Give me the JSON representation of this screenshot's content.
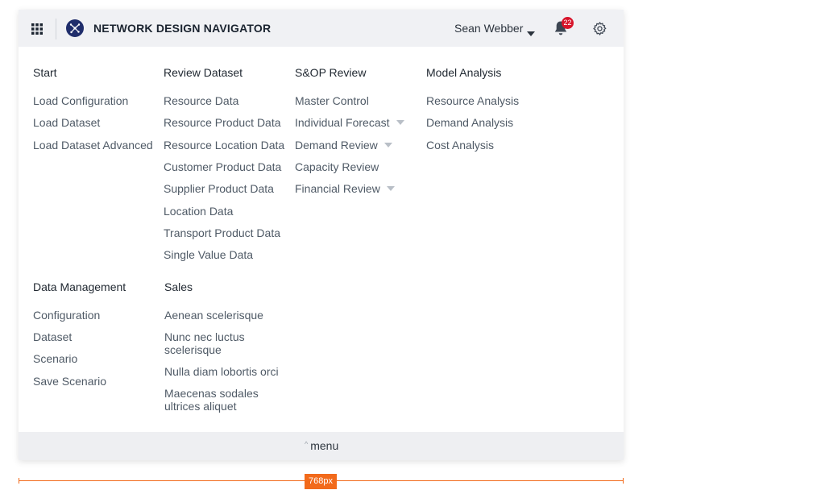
{
  "header": {
    "apps_icon": "grid-icon",
    "logo_icon": "network-logo-icon",
    "title": "NETWORK DESIGN NAVIGATOR",
    "user_name": "Sean Webber",
    "notification_count": "22",
    "settings_icon": "gear-icon",
    "colors": {
      "bar_bg": "#f0f1f4",
      "logo": "#1f2d6b",
      "badge": "#d7142a"
    }
  },
  "sections": {
    "start": {
      "title": "Start",
      "items": [
        "Load Configuration",
        "Load Dataset",
        "Load Dataset Advanced"
      ]
    },
    "review_dataset": {
      "title": "Review Dataset",
      "items": [
        "Resource Data",
        "Resource Product Data",
        "Resource Location Data",
        "Customer Product Data",
        "Supplier Product Data",
        "Location Data",
        "Transport Product Data",
        "Single Value Data"
      ]
    },
    "sop_review": {
      "title": "S&OP Review",
      "items": [
        "Master Control",
        "Individual Forecast",
        "Demand Review",
        "Capacity Review",
        "Financial Review"
      ]
    },
    "model_analysis": {
      "title": "Model Analysis",
      "items": [
        "Resource Analysis",
        "Demand Analysis",
        "Cost Analysis"
      ]
    },
    "data_management": {
      "title": "Data Management",
      "items": [
        "Configuration",
        "Dataset",
        "Scenario",
        "Save Scenario"
      ]
    },
    "sales": {
      "title": "Sales",
      "items": [
        "Aenean scelerisque",
        "Nunc nec luctus scelerisque",
        "Nulla diam lobortis orci",
        "Maecenas sodales ultrices aliquet"
      ]
    }
  },
  "footer": {
    "toggle_label": "menu",
    "toggle_icon": "chevron-up-icon"
  },
  "ruler": {
    "label": "768px",
    "color": "#f26a1b"
  }
}
